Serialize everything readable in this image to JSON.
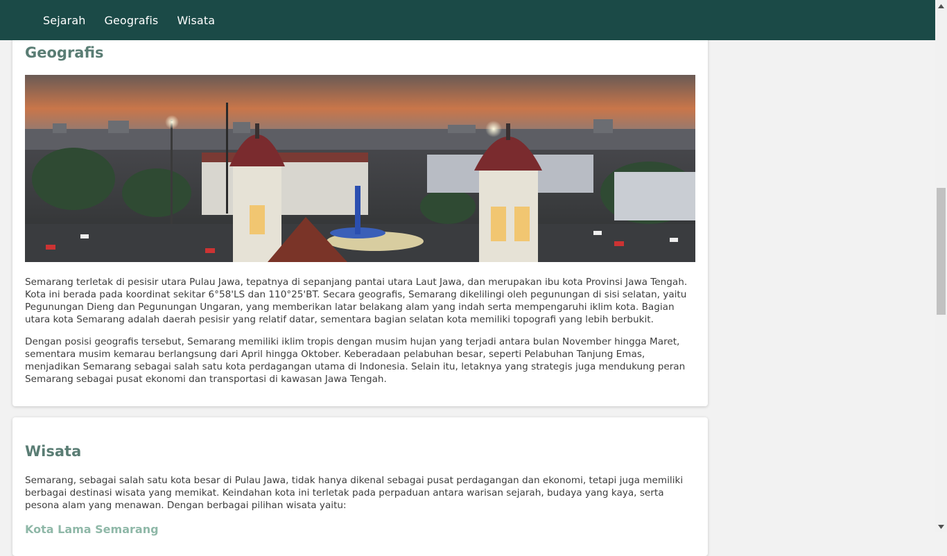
{
  "nav": {
    "items": [
      {
        "label": "Sejarah"
      },
      {
        "label": "Geografis"
      },
      {
        "label": "Wisata"
      }
    ]
  },
  "geografis": {
    "title": "Geografis",
    "image_alt_icon": "city-panorama-image",
    "paragraphs": [
      "Semarang terletak di pesisir utara Pulau Jawa, tepatnya di sepanjang pantai utara Laut Jawa, dan merupakan ibu kota Provinsi Jawa Tengah. Kota ini berada pada koordinat sekitar 6°58'LS dan 110°25'BT. Secara geografis, Semarang dikelilingi oleh pegunungan di sisi selatan, yaitu Pegunungan Dieng dan Pegunungan Ungaran, yang memberikan latar belakang alam yang indah serta mempengaruhi iklim kota. Bagian utara kota Semarang adalah daerah pesisir yang relatif datar, sementara bagian selatan kota memiliki topografi yang lebih berbukit.",
      "Dengan posisi geografis tersebut, Semarang memiliki iklim tropis dengan musim hujan yang terjadi antara bulan November hingga Maret, sementara musim kemarau berlangsung dari April hingga Oktober. Keberadaan pelabuhan besar, seperti Pelabuhan Tanjung Emas, menjadikan Semarang sebagai salah satu kota perdagangan utama di Indonesia. Selain itu, letaknya yang strategis juga mendukung peran Semarang sebagai pusat ekonomi dan transportasi di kawasan Jawa Tengah."
    ]
  },
  "wisata": {
    "title": "Wisata",
    "intro": "Semarang, sebagai salah satu kota besar di Pulau Jawa, tidak hanya dikenal sebagai pusat perdagangan dan ekonomi, tetapi juga memiliki berbagai destinasi wisata yang memikat. Keindahan kota ini terletak pada perpaduan antara warisan sejarah, budaya yang kaya, serta pesona alam yang menawan. Dengan berbagai pilihan wisata yaitu:",
    "first_item": "Kota Lama Semarang"
  },
  "colors": {
    "navbar": "#1b4a47",
    "heading": "#5a7d74",
    "subheading": "#8fb8a8"
  }
}
